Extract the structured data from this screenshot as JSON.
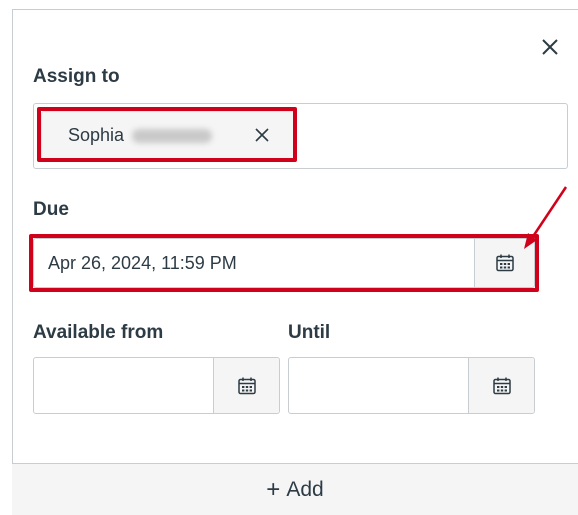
{
  "assign": {
    "label": "Assign to",
    "chip_name": "Sophia"
  },
  "due": {
    "label": "Due",
    "value": "Apr 26, 2024, 11:59 PM"
  },
  "available_from": {
    "label": "Available from",
    "value": ""
  },
  "until": {
    "label": "Until",
    "value": ""
  },
  "footer": {
    "plus": "+",
    "add_label": "Add"
  },
  "colors": {
    "highlight": "#d0021b",
    "border": "#c7cdd1",
    "text": "#2d3b45"
  },
  "icons": {
    "close": "close-icon",
    "remove": "remove-chip-icon",
    "calendar": "calendar-icon",
    "annotation": "arrow-annotation"
  }
}
